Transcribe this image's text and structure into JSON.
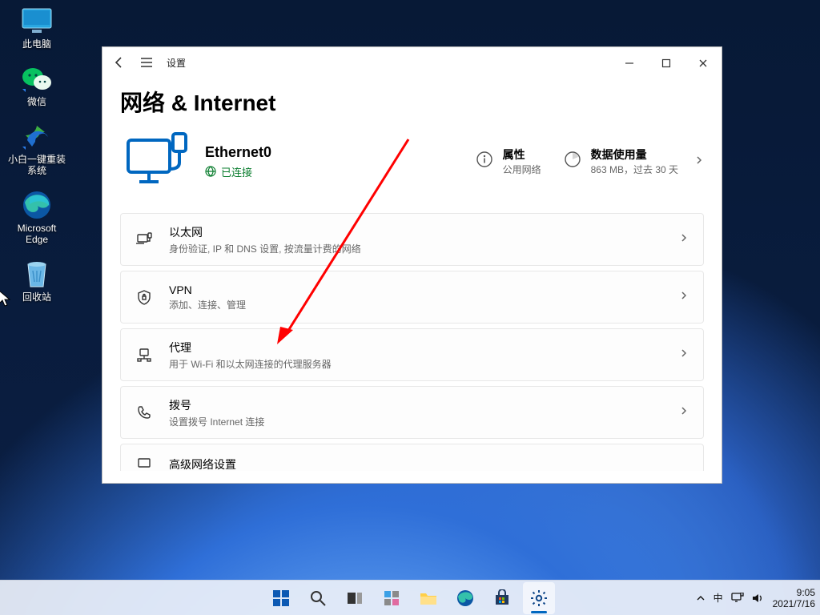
{
  "desktop": {
    "icons": [
      {
        "name": "pc",
        "label": "此电脑"
      },
      {
        "name": "wechat",
        "label": "微信"
      },
      {
        "name": "reinstall",
        "label": "小白一键重装\n系统"
      },
      {
        "name": "edge",
        "label": "Microsoft\nEdge"
      },
      {
        "name": "recycle",
        "label": "回收站"
      }
    ]
  },
  "window": {
    "title": "设置",
    "heading": "网络 & Internet",
    "connection": {
      "name": "Ethernet0",
      "state": "已连接"
    },
    "stats": {
      "props": {
        "title": "属性",
        "sub": "公用网络"
      },
      "usage": {
        "title": "数据使用量",
        "sub": "863 MB，过去 30 天"
      }
    },
    "rows": [
      {
        "icon": "ethernet",
        "title": "以太网",
        "sub": "身份验证, IP 和 DNS 设置, 按流量计费的网络"
      },
      {
        "icon": "vpn",
        "title": "VPN",
        "sub": "添加、连接、管理"
      },
      {
        "icon": "proxy",
        "title": "代理",
        "sub": "用于 Wi-Fi 和以太网连接的代理服务器"
      },
      {
        "icon": "dialup",
        "title": "拨号",
        "sub": "设置拨号 Internet 连接"
      },
      {
        "icon": "advanced",
        "title": "高级网络设置",
        "sub": ""
      }
    ]
  },
  "taskbar": {
    "ime": "中",
    "time": "9:05",
    "date": "2021/7/16"
  }
}
